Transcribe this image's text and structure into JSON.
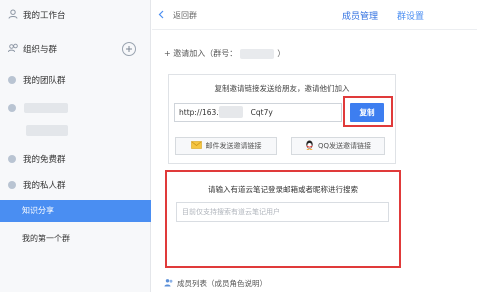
{
  "sidebar": {
    "workspace_label": "我的工作台",
    "org_label": "组织与群",
    "groups": [
      {
        "label": "我的团队群"
      },
      {
        "label": "我的免费群"
      },
      {
        "label": "我的私人群"
      }
    ],
    "sub_items": [
      {
        "label": "知识分享",
        "active": true
      },
      {
        "label": "我的第一个群",
        "active": false
      }
    ],
    "add_icon": "plus-circle-icon"
  },
  "header": {
    "back_label": "返回群",
    "tabs": [
      {
        "label": "成员管理",
        "active": true
      },
      {
        "label": "群设置",
        "active": false
      }
    ]
  },
  "invite": {
    "title_prefix": "+ 邀请加入（群号：",
    "title_suffix": "）",
    "hint": "复制邀请链接发送给朋友，邀请他们加入",
    "link_value_start": "http://163.fm",
    "link_value_end": "Cqt7y",
    "copy_label": "复制",
    "mail_label": "邮件发送邀请链接",
    "qq_label": "QQ发送邀请链接"
  },
  "search": {
    "hint": "请输入有道云笔记登录邮箱或者昵称进行搜索",
    "placeholder": "目前仅支持搜索有道云笔记用户"
  },
  "members": {
    "label": "成员列表（成员角色说明）"
  },
  "colors": {
    "accent": "#4a8ef2",
    "button": "#3d7ef0",
    "highlight": "#e03a3a",
    "sidebar_bg": "#f7f8fa"
  }
}
